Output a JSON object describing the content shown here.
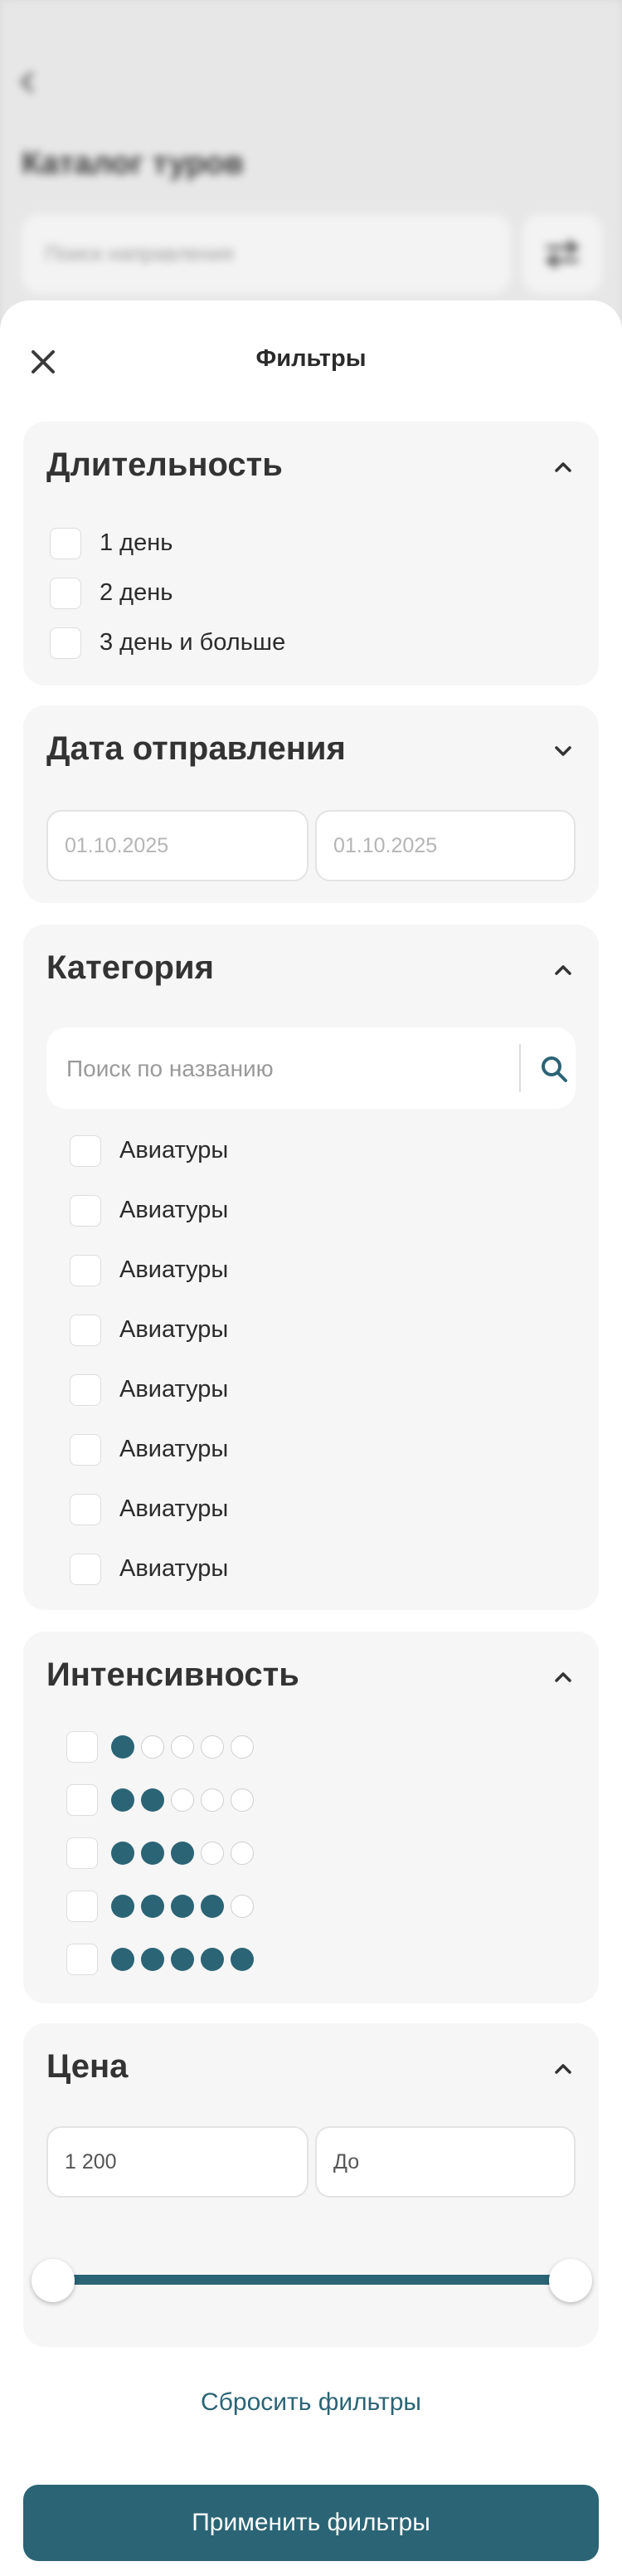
{
  "background": {
    "title": "Каталог туров",
    "search_placeholder": "Поиск направления"
  },
  "sheet": {
    "title": "Фильтры"
  },
  "duration": {
    "title": "Длительность",
    "options": [
      {
        "label": "1 день",
        "checked": false
      },
      {
        "label": "2 день",
        "checked": false
      },
      {
        "label": "3 день и больше",
        "checked": false
      }
    ]
  },
  "departure": {
    "title": "Дата отправления",
    "from_placeholder": "01.10.2025",
    "to_placeholder": "01.10.2025"
  },
  "category": {
    "title": "Категория",
    "search_placeholder": "Поиск по названию",
    "items": [
      {
        "label": "Авиатуры",
        "checked": false
      },
      {
        "label": "Авиатуры",
        "checked": false
      },
      {
        "label": "Авиатуры",
        "checked": false
      },
      {
        "label": "Авиатуры",
        "checked": false
      },
      {
        "label": "Авиатуры",
        "checked": false
      },
      {
        "label": "Авиатуры",
        "checked": false
      },
      {
        "label": "Авиатуры",
        "checked": false
      },
      {
        "label": "Авиатуры",
        "checked": false
      }
    ]
  },
  "intensity": {
    "title": "Интенсивность",
    "levels": [
      {
        "level": 1,
        "max": 5,
        "checked": false
      },
      {
        "level": 2,
        "max": 5,
        "checked": false
      },
      {
        "level": 3,
        "max": 5,
        "checked": false
      },
      {
        "level": 4,
        "max": 5,
        "checked": false
      },
      {
        "level": 5,
        "max": 5,
        "checked": false
      }
    ]
  },
  "price": {
    "title": "Цена",
    "from_value": "1 200",
    "to_placeholder": "До",
    "range_min_fraction": 0.0,
    "range_max_fraction": 1.0
  },
  "actions": {
    "reset_label": "Сбросить фильтры",
    "apply_label": "Применить фильтры"
  },
  "colors": {
    "accent": "#2b6475",
    "card_bg": "#f6f6f6",
    "sheet_bg": "#ffffff"
  },
  "icons": {
    "close": "close-icon",
    "chevron_up": "chevron-up-icon",
    "chevron_down": "chevron-down-icon",
    "search": "search-icon",
    "back": "back-arrow-icon",
    "filter": "filter-icon"
  }
}
